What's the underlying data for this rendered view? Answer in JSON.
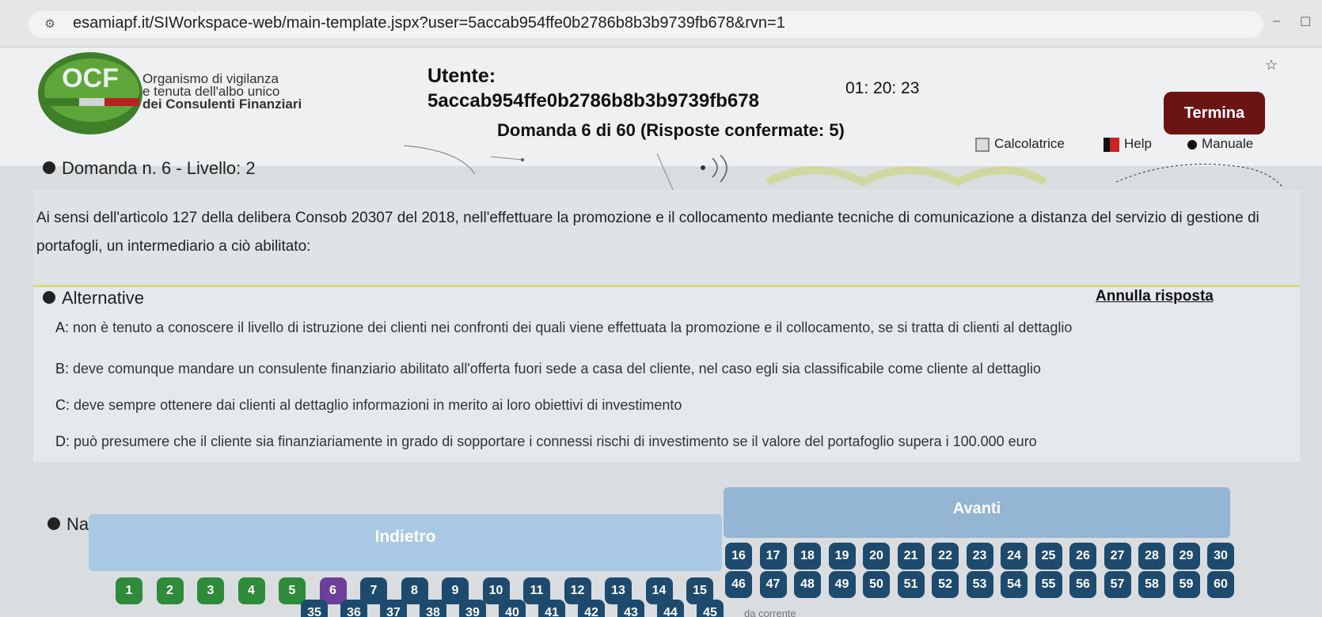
{
  "browser": {
    "url": "esamiapf.it/SIWorkspace-web/main-template.jspx?user=5accab954ffe0b2786b8b3b9739fb678&rvn=1",
    "site_icon": "site-info-icon"
  },
  "header": {
    "logo_text": "OCF",
    "org_line1": "Organismo di vigilanza",
    "org_line2": "e tenuta dell'albo unico",
    "org_line3": "dei Consulenti Finanziari",
    "user_label": "Utente:",
    "user_id": "5accab954ffe0b2786b8b3b9739fb678",
    "timer": "01: 20: 23",
    "termina_label": "Termina",
    "progress": "Domanda 6 di 60 (Risposte confermate: 5)",
    "tools": {
      "calc": "Calcolatrice",
      "help": "Help",
      "manual": "Manuale"
    }
  },
  "question": {
    "title": "Domanda n. 6 - Livello: 2",
    "text_line1": "Ai sensi dell'articolo 127 della delibera Consob 20307 del 2018, nell'effettuare la promozione e il collocamento mediante tecniche di comunicazione a distanza del servizio di gestione di",
    "text_line2": "portafogli, un intermediario a ciò abilitato:"
  },
  "alternatives": {
    "title": "Alternative",
    "annulla": "Annulla risposta",
    "items": [
      {
        "letter": "A:",
        "text": "non è tenuto a conoscere il livello di istruzione dei clienti nei confronti dei quali viene effettuata la promozione e il collocamento, se si tratta di clienti al dettaglio"
      },
      {
        "letter": "B:",
        "text": "deve comunque mandare un consulente finanziario abilitato all'offerta fuori sede a casa del cliente, nel caso egli sia classificabile come cliente al dettaglio"
      },
      {
        "letter": "C:",
        "text": "deve sempre ottenere dai clienti al dettaglio informazioni in merito ai loro obiettivi di investimento"
      },
      {
        "letter": "D:",
        "text": "può presumere che il cliente sia finanziariamente in grado di sopportare i connessi rischi di investimento se il valore del portafoglio supera i 100.000 euro"
      }
    ]
  },
  "navigation": {
    "title": "Navigazione",
    "back_label": "Indietro",
    "next_label": "Avanti",
    "current": 6,
    "answered": [
      1,
      2,
      3,
      4,
      5
    ],
    "numbers_row1": [
      16,
      17,
      18,
      19,
      20,
      21,
      22,
      23,
      24,
      25,
      26,
      27,
      28,
      29,
      30
    ],
    "numbers_row2": [
      1,
      2,
      3,
      4,
      5,
      6,
      7,
      8,
      9,
      10,
      11,
      12,
      13,
      14,
      15,
      46,
      47,
      48,
      49,
      50,
      51,
      52,
      53,
      54,
      55,
      56,
      57,
      58,
      59,
      60
    ],
    "numbers_row3": [
      35,
      36,
      37,
      38,
      39,
      40,
      41,
      42,
      43,
      44,
      45
    ],
    "footer_partial": "da corrente"
  },
  "colors": {
    "answered": "#2e8b3a",
    "pending": "#1e4a6e",
    "current": "#6b3f9a",
    "termina": "#6b1414"
  }
}
